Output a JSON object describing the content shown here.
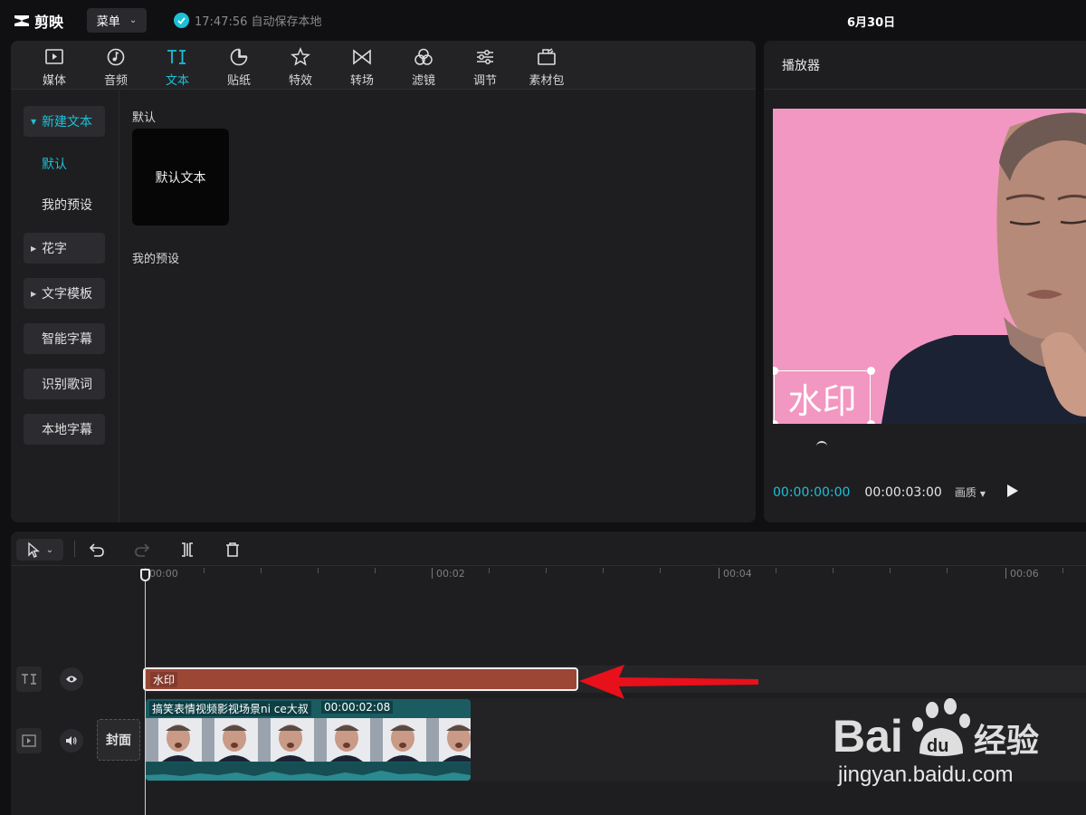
{
  "app": {
    "name": "剪映",
    "menu_label": "菜单",
    "autosave_text": "17:47:56 自动保存本地",
    "date": "6月30日"
  },
  "tabs": [
    {
      "label": "媒体",
      "icon": "media-icon"
    },
    {
      "label": "音频",
      "icon": "audio-icon"
    },
    {
      "label": "文本",
      "icon": "text-icon",
      "active": true
    },
    {
      "label": "贴纸",
      "icon": "sticker-icon"
    },
    {
      "label": "特效",
      "icon": "effects-icon"
    },
    {
      "label": "转场",
      "icon": "transition-icon"
    },
    {
      "label": "滤镜",
      "icon": "filter-icon"
    },
    {
      "label": "调节",
      "icon": "adjust-icon"
    },
    {
      "label": "素材包",
      "icon": "package-icon"
    }
  ],
  "sidebar": {
    "items": [
      {
        "label": "新建文本",
        "expanded": true
      },
      {
        "label": "默认",
        "selected": true
      },
      {
        "label": "我的预设"
      },
      {
        "label": "花字"
      },
      {
        "label": "文字模板"
      },
      {
        "label": "智能字幕"
      },
      {
        "label": "识别歌词"
      },
      {
        "label": "本地字幕"
      }
    ]
  },
  "content": {
    "section_default": "默认",
    "default_card": "默认文本",
    "section_presets": "我的预设"
  },
  "player": {
    "title": "播放器",
    "watermark_text": "水印",
    "current_time": "00:00:00:00",
    "total_time": "00:00:03:00",
    "quality_label": "画质"
  },
  "timeline": {
    "ruler_labels": [
      "00:00",
      "00:02",
      "00:04",
      "00:06"
    ],
    "text_clip_label": "水印",
    "video_clip_title": "搞笑表情视频影视场景ni ce大叔",
    "video_clip_duration": "00:00:02:08",
    "cover_label": "封面"
  },
  "watermark": {
    "brand": "Bai du 经验",
    "site": "jingyan.baidu.com"
  },
  "colors": {
    "accent": "#1cc0d6",
    "text_clip": "#9c4636",
    "video_clip": "#1a5c62",
    "preview_bg": "#f297c1",
    "arrow": "#e8101a"
  }
}
